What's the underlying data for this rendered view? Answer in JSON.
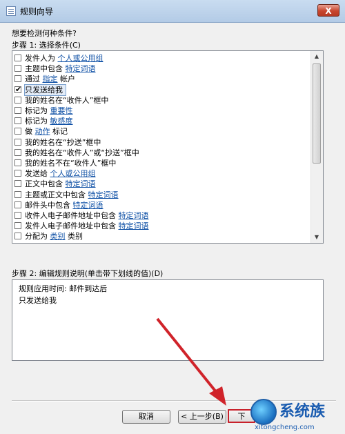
{
  "window": {
    "title": "规则向导",
    "close_label": "X"
  },
  "question": "想要检测何种条件?",
  "step1_label": "步骤 1: 选择条件(C)",
  "conditions": [
    {
      "parts": [
        {
          "t": "发件人为 "
        },
        {
          "t": "个人或公用组",
          "link": true
        }
      ],
      "checked": false
    },
    {
      "parts": [
        {
          "t": "主题中包含 "
        },
        {
          "t": "特定词语",
          "link": true
        }
      ],
      "checked": false
    },
    {
      "parts": [
        {
          "t": "通过 "
        },
        {
          "t": "指定",
          "link": true
        },
        {
          "t": " 帐户"
        }
      ],
      "checked": false
    },
    {
      "parts": [
        {
          "t": "只发送给我"
        }
      ],
      "checked": true,
      "selected": true
    },
    {
      "parts": [
        {
          "t": "我的姓名在“收件人”框中"
        }
      ],
      "checked": false
    },
    {
      "parts": [
        {
          "t": "标记为 "
        },
        {
          "t": "重要性",
          "link": true
        }
      ],
      "checked": false
    },
    {
      "parts": [
        {
          "t": "标记为 "
        },
        {
          "t": "敏感度",
          "link": true
        }
      ],
      "checked": false
    },
    {
      "parts": [
        {
          "t": "做 "
        },
        {
          "t": "动作",
          "link": true
        },
        {
          "t": " 标记"
        }
      ],
      "checked": false
    },
    {
      "parts": [
        {
          "t": "我的姓名在“抄送”框中"
        }
      ],
      "checked": false
    },
    {
      "parts": [
        {
          "t": "我的姓名在“收件人”或“抄送”框中"
        }
      ],
      "checked": false
    },
    {
      "parts": [
        {
          "t": "我的姓名不在“收件人”框中"
        }
      ],
      "checked": false
    },
    {
      "parts": [
        {
          "t": "发送给 "
        },
        {
          "t": "个人或公用组",
          "link": true
        }
      ],
      "checked": false
    },
    {
      "parts": [
        {
          "t": "正文中包含 "
        },
        {
          "t": "特定词语",
          "link": true
        }
      ],
      "checked": false
    },
    {
      "parts": [
        {
          "t": "主题或正文中包含 "
        },
        {
          "t": "特定词语",
          "link": true
        }
      ],
      "checked": false
    },
    {
      "parts": [
        {
          "t": "邮件头中包含 "
        },
        {
          "t": "特定词语",
          "link": true
        }
      ],
      "checked": false
    },
    {
      "parts": [
        {
          "t": "收件人电子邮件地址中包含 "
        },
        {
          "t": "特定词语",
          "link": true
        }
      ],
      "checked": false
    },
    {
      "parts": [
        {
          "t": "发件人电子邮件地址中包含 "
        },
        {
          "t": "特定词语",
          "link": true
        }
      ],
      "checked": false
    },
    {
      "parts": [
        {
          "t": "分配为 "
        },
        {
          "t": "类别",
          "link": true
        },
        {
          "t": " 类别"
        }
      ],
      "checked": false
    }
  ],
  "step2_label": "步骤 2: 编辑规则说明(单击带下划线的值)(D)",
  "description_lines": [
    "规则应用时间: 邮件到达后",
    "只发送给我"
  ],
  "buttons": {
    "cancel": "取消",
    "back": "< 上一步(B)",
    "next": "下"
  },
  "watermark": {
    "brand": "系统族",
    "url": "xitongcheng.com"
  },
  "colors": {
    "link": "#0d4fa5",
    "arrow": "#d0232a",
    "selection": "#e3ecf8"
  }
}
